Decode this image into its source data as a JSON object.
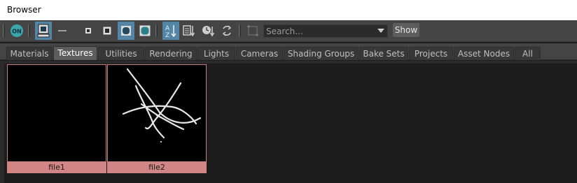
{
  "window": {
    "title": "Browser"
  },
  "toolbar": {
    "on_label": "ON",
    "search_placeholder": "Search...",
    "show_label": "Show",
    "accent": "#5285a6",
    "icons": [
      "on-toggle-icon",
      "render-swatch-icon",
      "line-icon",
      "small-swatch-icon",
      "medium-swatch-icon",
      "large-swatch-icon",
      "xlarge-swatch-icon",
      "sort-alpha-icon",
      "sort-type-icon",
      "sort-time-icon",
      "refresh-icon",
      "frame-icon"
    ]
  },
  "tabs": [
    {
      "label": "Materials",
      "active": false
    },
    {
      "label": "Textures",
      "active": true
    },
    {
      "label": "Utilities",
      "active": false
    },
    {
      "label": "Rendering",
      "active": false
    },
    {
      "label": "Lights",
      "active": false
    },
    {
      "label": "Cameras",
      "active": false
    },
    {
      "label": "Shading Groups",
      "active": false
    },
    {
      "label": "Bake Sets",
      "active": false
    },
    {
      "label": "Projects",
      "active": false
    },
    {
      "label": "Asset Nodes",
      "active": false
    },
    {
      "label": "All",
      "active": false
    }
  ],
  "swatches": [
    {
      "label": "file1"
    },
    {
      "label": "file2"
    }
  ]
}
